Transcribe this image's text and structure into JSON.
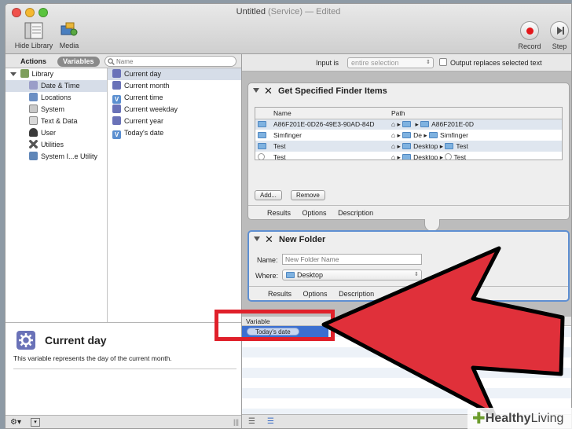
{
  "window": {
    "title": "Untitled",
    "subtitle": "(Service) — Edited"
  },
  "toolbar": {
    "hide_library": "Hide Library",
    "media": "Media",
    "record": "Record",
    "step": "Step"
  },
  "left": {
    "tab_actions": "Actions",
    "tab_variables": "Variables",
    "search_placeholder": "Name",
    "library_root": "Library",
    "categories": [
      "Date & Time",
      "Locations",
      "System",
      "Text & Data",
      "User",
      "Utilities",
      "System I...e Utility"
    ],
    "variables": [
      "Current day",
      "Current month",
      "Current time",
      "Current weekday",
      "Current year",
      "Today's date"
    ],
    "info_title": "Current day",
    "info_desc": "This variable represents the day of the current month."
  },
  "workflow": {
    "input_label": "Input is",
    "input_value": "entire selection",
    "output_checkbox": "Output replaces selected text",
    "action1": {
      "title": "Get Specified Finder Items",
      "col_name": "Name",
      "col_path": "Path",
      "rows": [
        {
          "name": "A86F201E-0D26-49E3-90AD-84D",
          "path1": "",
          "path2": "A86F201E-0D"
        },
        {
          "name": "Simfinger",
          "path1": "De",
          "path2": "Simfinger"
        },
        {
          "name": "Test",
          "path1": "Desktop",
          "path2": "Test"
        },
        {
          "name": "Test",
          "path1": "Desktop",
          "path2": "Test"
        }
      ],
      "add_button": "Add...",
      "remove_button": "Remove",
      "tabs": [
        "Results",
        "Options",
        "Description"
      ]
    },
    "action2": {
      "title": "New Folder",
      "name_label": "Name:",
      "name_placeholder": "New Folder Name",
      "where_label": "Where:",
      "where_value": "Desktop",
      "tabs": [
        "Results",
        "Options",
        "Description"
      ]
    },
    "variable_header": "Variable",
    "variable_token": "Today's date"
  },
  "watermark": {
    "part1": "Healthy",
    "part2": "Living"
  },
  "colors": {
    "accent_red": "#e0202a",
    "selection_blue": "#3b6fd1"
  }
}
